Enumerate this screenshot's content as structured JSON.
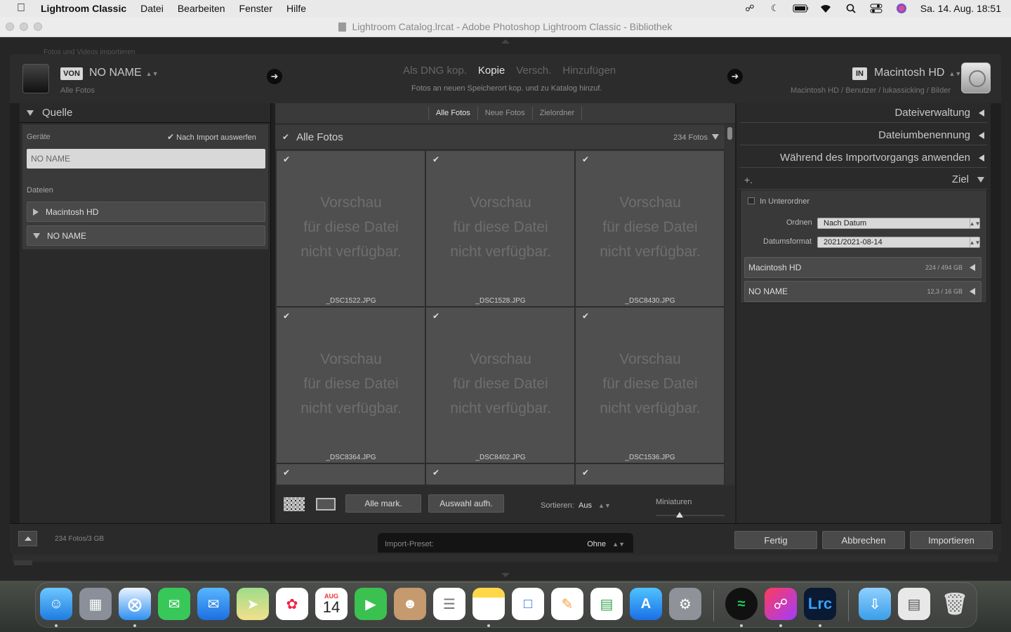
{
  "menubar": {
    "app_name": "Lightroom Classic",
    "items": [
      "Datei",
      "Bearbeiten",
      "Fenster",
      "Hilfe"
    ],
    "clock": "Sa. 14. Aug.  18:51"
  },
  "window": {
    "title": "Lightroom Catalog.lrcat - Adobe Photoshop Lightroom Classic - Bibliothek",
    "ghost_text": "Fotos und Videos importieren"
  },
  "import_bar": {
    "source_badge": "VON",
    "source_name": "NO NAME",
    "source_sub": "Alle Fotos",
    "modes": [
      "Als DNG kop.",
      "Kopie",
      "Versch.",
      "Hinzufügen"
    ],
    "active_mode": "Kopie",
    "mode_desc": "Fotos an neuen Speicherort kop. und zu Katalog hinzuf.",
    "dest_badge": "IN",
    "dest_name": "Macintosh HD",
    "dest_path": "Macintosh HD / Benutzer / lukassicking / Bilder"
  },
  "source_panel": {
    "title": "Quelle",
    "devices_label": "Geräte",
    "eject_label": "Nach Import auswerfen",
    "device": "NO NAME",
    "files_label": "Dateien",
    "folders": [
      "Macintosh HD",
      "NO NAME"
    ]
  },
  "grid": {
    "tabs": [
      "Alle Fotos",
      "Neue Fotos",
      "Zielordner"
    ],
    "active_tab": "Alle Fotos",
    "header": "Alle Fotos",
    "count": "234 Fotos",
    "preview_lines": [
      "Vorschau",
      "für diese Datei",
      "nicht verfügbar."
    ],
    "files": [
      "_DSC1522.JPG",
      "_DSC1528.JPG",
      "_DSC8430.JPG",
      "_DSC8364.JPG",
      "_DSC8402.JPG",
      "_DSC1536.JPG"
    ]
  },
  "grid_toolbar": {
    "select_all": "Alle mark.",
    "deselect": "Auswahl aufh.",
    "sort_label": "Sortieren:",
    "sort_value": "Aus",
    "thumbnails_label": "Miniaturen",
    "thumbnail_size": 0.35
  },
  "right_panel": {
    "sections": [
      "Dateiverwaltung",
      "Dateiumbenennung",
      "Während des Importvorgangs anwenden"
    ],
    "dest_title": "Ziel",
    "dest_plus": "+.",
    "subfolder_label": "In Unterordner",
    "order_label": "Ordnen",
    "order_value": "Nach Datum",
    "date_format_label": "Datumsformat",
    "date_format_value": "2021/2021-08-14",
    "volumes": [
      {
        "name": "Macintosh HD",
        "size": "224 / 494 GB"
      },
      {
        "name": "NO NAME",
        "size": "12,3 / 16 GB"
      }
    ]
  },
  "footer": {
    "status": "234 Fotos/3 GB",
    "preset_label": "Import-Preset:",
    "preset_value": "Ohne",
    "done": "Fertig",
    "cancel": "Abbrechen",
    "import": "Importieren"
  },
  "dock": {
    "calendar_month": "AUG",
    "calendar_day": "14",
    "lrc_label": "Lrc"
  }
}
